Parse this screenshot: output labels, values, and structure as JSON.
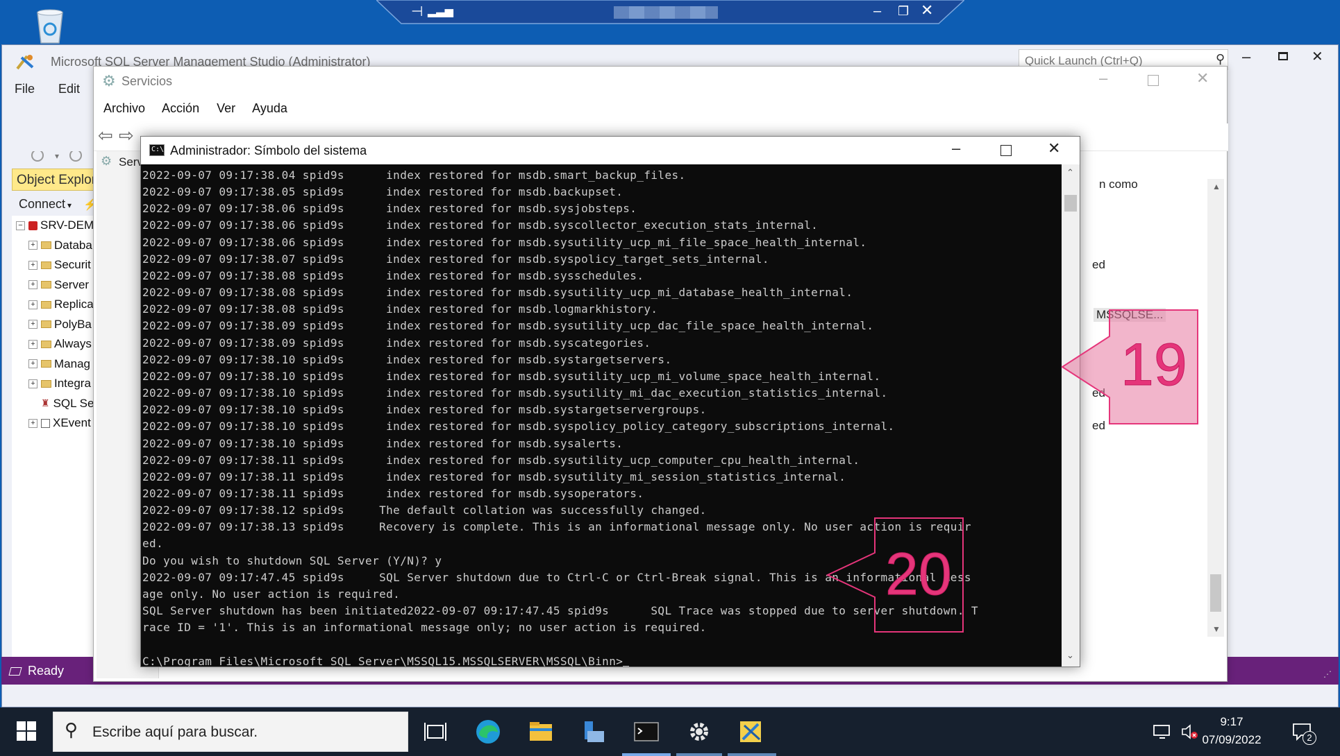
{
  "ssms": {
    "title": "Microsoft SQL Server Management Studio (Administrator)",
    "quick_launch_placeholder": "Quick Launch (Ctrl+Q)",
    "menu": [
      "File",
      "Edit"
    ],
    "object_explorer": {
      "header": "Object Explorer",
      "connect_label": "Connect",
      "server": "SRV-DEM",
      "nodes": [
        "Databa",
        "Securit",
        "Server",
        "Replica",
        "PolyBa",
        "Always",
        "Manag",
        "Integra",
        "SQL Se",
        "XEvent"
      ]
    },
    "status": "Ready"
  },
  "services": {
    "title": "Servicios",
    "menu": [
      "Archivo",
      "Acción",
      "Ver",
      "Ayuda"
    ],
    "left_tab": "Serv",
    "right_fragments": [
      "n como",
      "ed",
      "MSSQLSE...",
      "ed",
      "ed"
    ]
  },
  "cmd": {
    "title": "Administrador: Símbolo del sistema",
    "lines": [
      "2022-09-07 09:17:38.04 spid9s      index restored for msdb.smart_backup_files.",
      "2022-09-07 09:17:38.05 spid9s      index restored for msdb.backupset.",
      "2022-09-07 09:17:38.06 spid9s      index restored for msdb.sysjobsteps.",
      "2022-09-07 09:17:38.06 spid9s      index restored for msdb.syscollector_execution_stats_internal.",
      "2022-09-07 09:17:38.06 spid9s      index restored for msdb.sysutility_ucp_mi_file_space_health_internal.",
      "2022-09-07 09:17:38.07 spid9s      index restored for msdb.syspolicy_target_sets_internal.",
      "2022-09-07 09:17:38.08 spid9s      index restored for msdb.sysschedules.",
      "2022-09-07 09:17:38.08 spid9s      index restored for msdb.sysutility_ucp_mi_database_health_internal.",
      "2022-09-07 09:17:38.08 spid9s      index restored for msdb.logmarkhistory.",
      "2022-09-07 09:17:38.09 spid9s      index restored for msdb.sysutility_ucp_dac_file_space_health_internal.",
      "2022-09-07 09:17:38.09 spid9s      index restored for msdb.syscategories.",
      "2022-09-07 09:17:38.10 spid9s      index restored for msdb.systargetservers.",
      "2022-09-07 09:17:38.10 spid9s      index restored for msdb.sysutility_ucp_mi_volume_space_health_internal.",
      "2022-09-07 09:17:38.10 spid9s      index restored for msdb.sysutility_mi_dac_execution_statistics_internal.",
      "2022-09-07 09:17:38.10 spid9s      index restored for msdb.systargetservergroups.",
      "2022-09-07 09:17:38.10 spid9s      index restored for msdb.syspolicy_policy_category_subscriptions_internal.",
      "2022-09-07 09:17:38.10 spid9s      index restored for msdb.sysalerts.",
      "2022-09-07 09:17:38.11 spid9s      index restored for msdb.sysutility_ucp_computer_cpu_health_internal.",
      "2022-09-07 09:17:38.11 spid9s      index restored for msdb.sysutility_mi_session_statistics_internal.",
      "2022-09-07 09:17:38.11 spid9s      index restored for msdb.sysoperators.",
      "2022-09-07 09:17:38.12 spid9s     The default collation was successfully changed.",
      "2022-09-07 09:17:38.13 spid9s     Recovery is complete. This is an informational message only. No user action is requir",
      "ed.",
      "Do you wish to shutdown SQL Server (Y/N)? y",
      "2022-09-07 09:17:47.45 spid9s     SQL Server shutdown due to Ctrl-C or Ctrl-Break signal. This is an informational mess",
      "age only. No user action is required.",
      "SQL Server shutdown has been initiated2022-09-07 09:17:47.45 spid9s      SQL Trace was stopped due to server shutdown. T",
      "race ID = '1'. This is an informational message only; no user action is required.",
      "",
      "C:\\Program Files\\Microsoft SQL Server\\MSSQL15.MSSQLSERVER\\MSSQL\\Binn>"
    ]
  },
  "callouts": [
    {
      "number": "19",
      "direction": "left"
    },
    {
      "number": "20",
      "direction": "left"
    }
  ],
  "taskbar": {
    "search_placeholder": "Escribe aquí para buscar.",
    "time": "9:17",
    "date": "07/09/2022",
    "notification_count": "2",
    "pinned": [
      "task-view",
      "edge",
      "file-explorer",
      "server-manager",
      "command-prompt",
      "services",
      "ssms"
    ]
  },
  "colors": {
    "desktop": "#0d5db3",
    "ssms_status": "#68217a",
    "callout": "#e5357a",
    "taskbar": "#16202e",
    "console_bg": "#0c0c0c",
    "console_text": "#cccccc"
  }
}
